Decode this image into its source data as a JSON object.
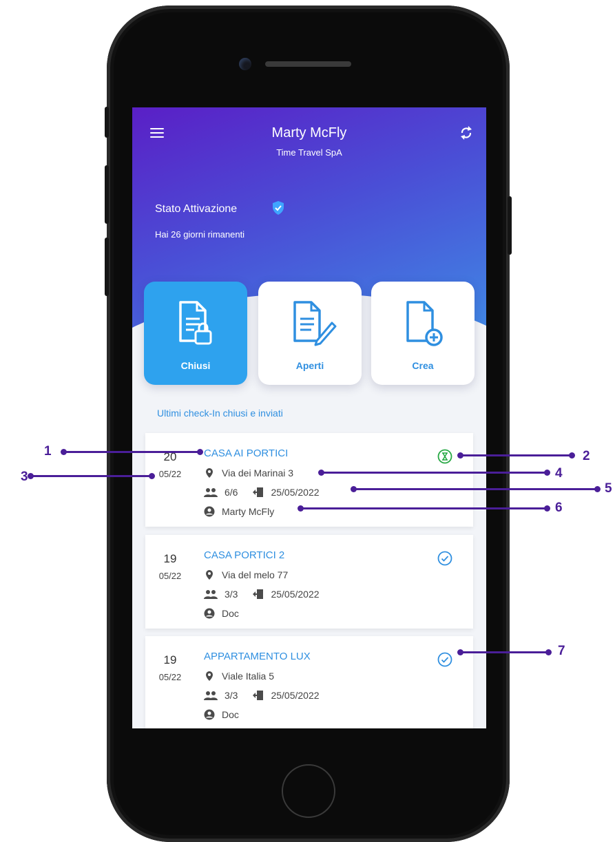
{
  "header": {
    "user_name": "Marty McFly",
    "company": "Time Travel SpA",
    "menu_icon": "hamburger-menu-icon",
    "sync_icon": "sync-icon"
  },
  "activation": {
    "title": "Stato Attivazione",
    "days_text": "Hai 26 giorni rimanenti",
    "icon": "verified-shield-icon"
  },
  "tiles": [
    {
      "label": "Chiusi",
      "icon": "closed-document-lock-icon",
      "active": true
    },
    {
      "label": "Aperti",
      "icon": "open-document-edit-icon",
      "active": false
    },
    {
      "label": "Crea",
      "icon": "create-document-plus-icon",
      "active": false
    }
  ],
  "section_title": "Ultimi check-In chiusi e inviati",
  "checkins": [
    {
      "day": "20",
      "month": "05/22",
      "title": "CASA AI PORTICI",
      "address": "Via dei Marinai 3",
      "guests": "6/6",
      "checkout_date": "25/05/2022",
      "operator": "Marty McFly",
      "status": "pending",
      "status_icon": "hourglass-icon"
    },
    {
      "day": "19",
      "month": "05/22",
      "title": "CASA PORTICI 2",
      "address": "Via del melo 77",
      "guests": "3/3",
      "checkout_date": "25/05/2022",
      "operator": "Doc",
      "status": "sent",
      "status_icon": "check-circle-icon"
    },
    {
      "day": "19",
      "month": "05/22",
      "title": "APPARTAMENTO LUX",
      "address": "Viale Italia 5",
      "guests": "3/3",
      "checkout_date": "25/05/2022",
      "operator": "Doc",
      "status": "sent",
      "status_icon": "check-circle-icon"
    }
  ],
  "callouts": [
    "1",
    "2",
    "3",
    "4",
    "5",
    "6",
    "7"
  ],
  "colors": {
    "accent": "#2f8fe0",
    "tile_active": "#2ea2ee",
    "header_start": "#5a1fc6",
    "header_end": "#3f8ee6",
    "pending": "#27a844",
    "callout": "#4a1e98"
  }
}
